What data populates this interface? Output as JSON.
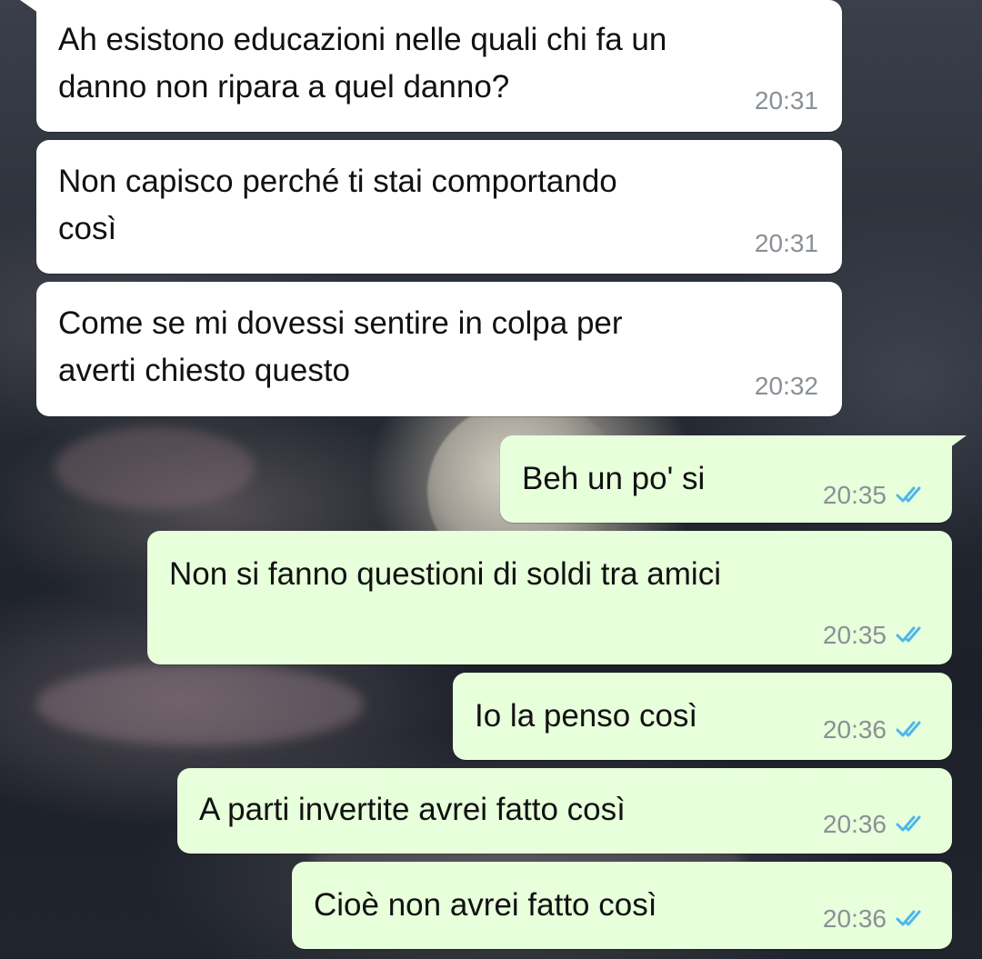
{
  "messages": [
    {
      "direction": "incoming",
      "text": "Ah esistono educazioni nelle quali chi fa un\ndanno non ripara a quel danno?",
      "time": "20:31"
    },
    {
      "direction": "incoming",
      "text": "Non capisco perché ti stai comportando\ncosì",
      "time": "20:31"
    },
    {
      "direction": "incoming",
      "text": "Come se mi dovessi sentire in colpa per\naverti chiesto questo",
      "time": "20:32"
    },
    {
      "direction": "outgoing",
      "text": "Beh un po' si",
      "time": "20:35",
      "status": "read"
    },
    {
      "direction": "outgoing",
      "text": "Non si fanno questioni di soldi tra amici",
      "time": "20:35",
      "status": "read"
    },
    {
      "direction": "outgoing",
      "text": "Io la penso così",
      "time": "20:36",
      "status": "read"
    },
    {
      "direction": "outgoing",
      "text": "A parti invertite avrei fatto così",
      "time": "20:36",
      "status": "read"
    },
    {
      "direction": "outgoing",
      "text": "Cioè non avrei fatto così",
      "time": "20:36",
      "status": "read"
    }
  ],
  "colors": {
    "incoming_bubble": "#ffffff",
    "outgoing_bubble": "#e7ffdb",
    "read_ticks": "#4fb6ec",
    "timestamp": "#8a9096"
  },
  "icons": {
    "read_status": "double-check-icon"
  }
}
